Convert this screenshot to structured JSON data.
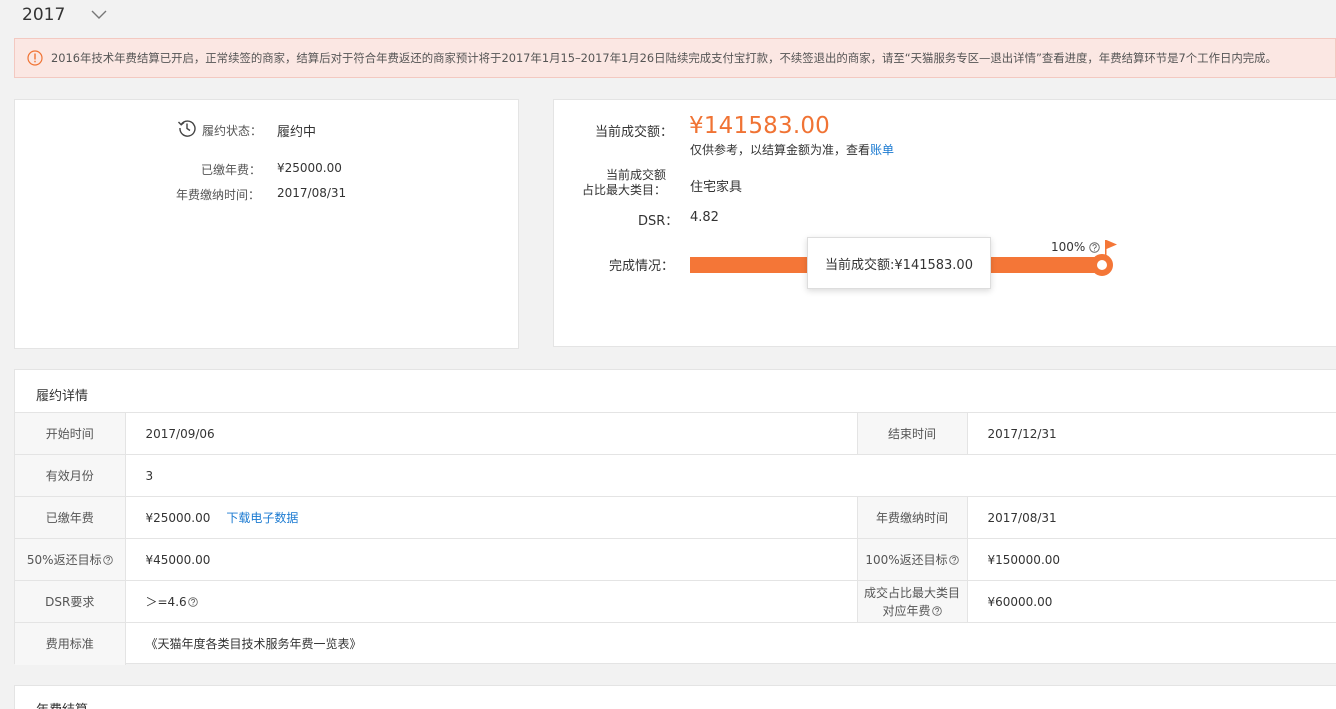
{
  "year_select": {
    "value": "2017"
  },
  "notice": {
    "text": "2016年技术年费结算已开启，正常续签的商家，结算后对于符合年费返还的商家预计将于2017年1月15–2017年1月26日陆续完成支付宝打款，不续签退出的商家，请至“天猫服务专区—退出详情”查看进度，年费结算环节是7个工作日内完成。"
  },
  "contract": {
    "status_label": "履约状态：",
    "status_value": "履约中",
    "paid_fee_label": "已缴年费：",
    "paid_fee_value": "¥25000.00",
    "pay_time_label": "年费缴纳时间：",
    "pay_time_value": "2017/08/31"
  },
  "performance": {
    "current_amount_label": "当前成交额：",
    "current_amount_value": "¥141583.00",
    "note_text": "仅供参考，以结算金额为准，查看",
    "note_link": "账单",
    "top_category_label_line1": "当前成交额",
    "top_category_label_line2": "占比最大类目：",
    "top_category_value": "住宅家具",
    "dsr_label": "DSR：",
    "dsr_value": "4.82",
    "progress_label": "完成情况：",
    "progress_percent_text": "100%",
    "progress_fraction": 1.0,
    "tooltip_text": "当前成交额:¥141583.00",
    "accent_color": "#f47637"
  },
  "detail": {
    "title": "履约详情",
    "start_label": "开始时间",
    "start_value": "2017/09/06",
    "end_label": "结束时间",
    "end_value": "2017/12/31",
    "months_label": "有效月份",
    "months_value": "3",
    "paid_label": "已缴年费",
    "paid_value": "¥25000.00",
    "download_link": "下载电子数据",
    "pay_time_label": "年费缴纳时间",
    "pay_time_value": "2017/08/31",
    "target50_label": "50%返还目标",
    "target50_value": "¥45000.00",
    "target100_label": "100%返还目标",
    "target100_value": "¥150000.00",
    "dsr_req_label": "DSR要求",
    "dsr_req_value": "＞=4.6",
    "top_cat_fee_label_line1": "成交占比最大类目",
    "top_cat_fee_label_line2": "对应年费",
    "top_cat_fee_value": "¥60000.00",
    "fee_std_label": "费用标准",
    "fee_std_value": "《天猫年度各类目技术服务年费一览表》"
  },
  "settlement": {
    "title": "年费结算"
  },
  "icons": {
    "year_chevron": "chevron-down-icon",
    "notice": "info-circle-icon",
    "status": "history-clock-icon",
    "help": "question-circle-icon",
    "flag": "flag-icon"
  }
}
